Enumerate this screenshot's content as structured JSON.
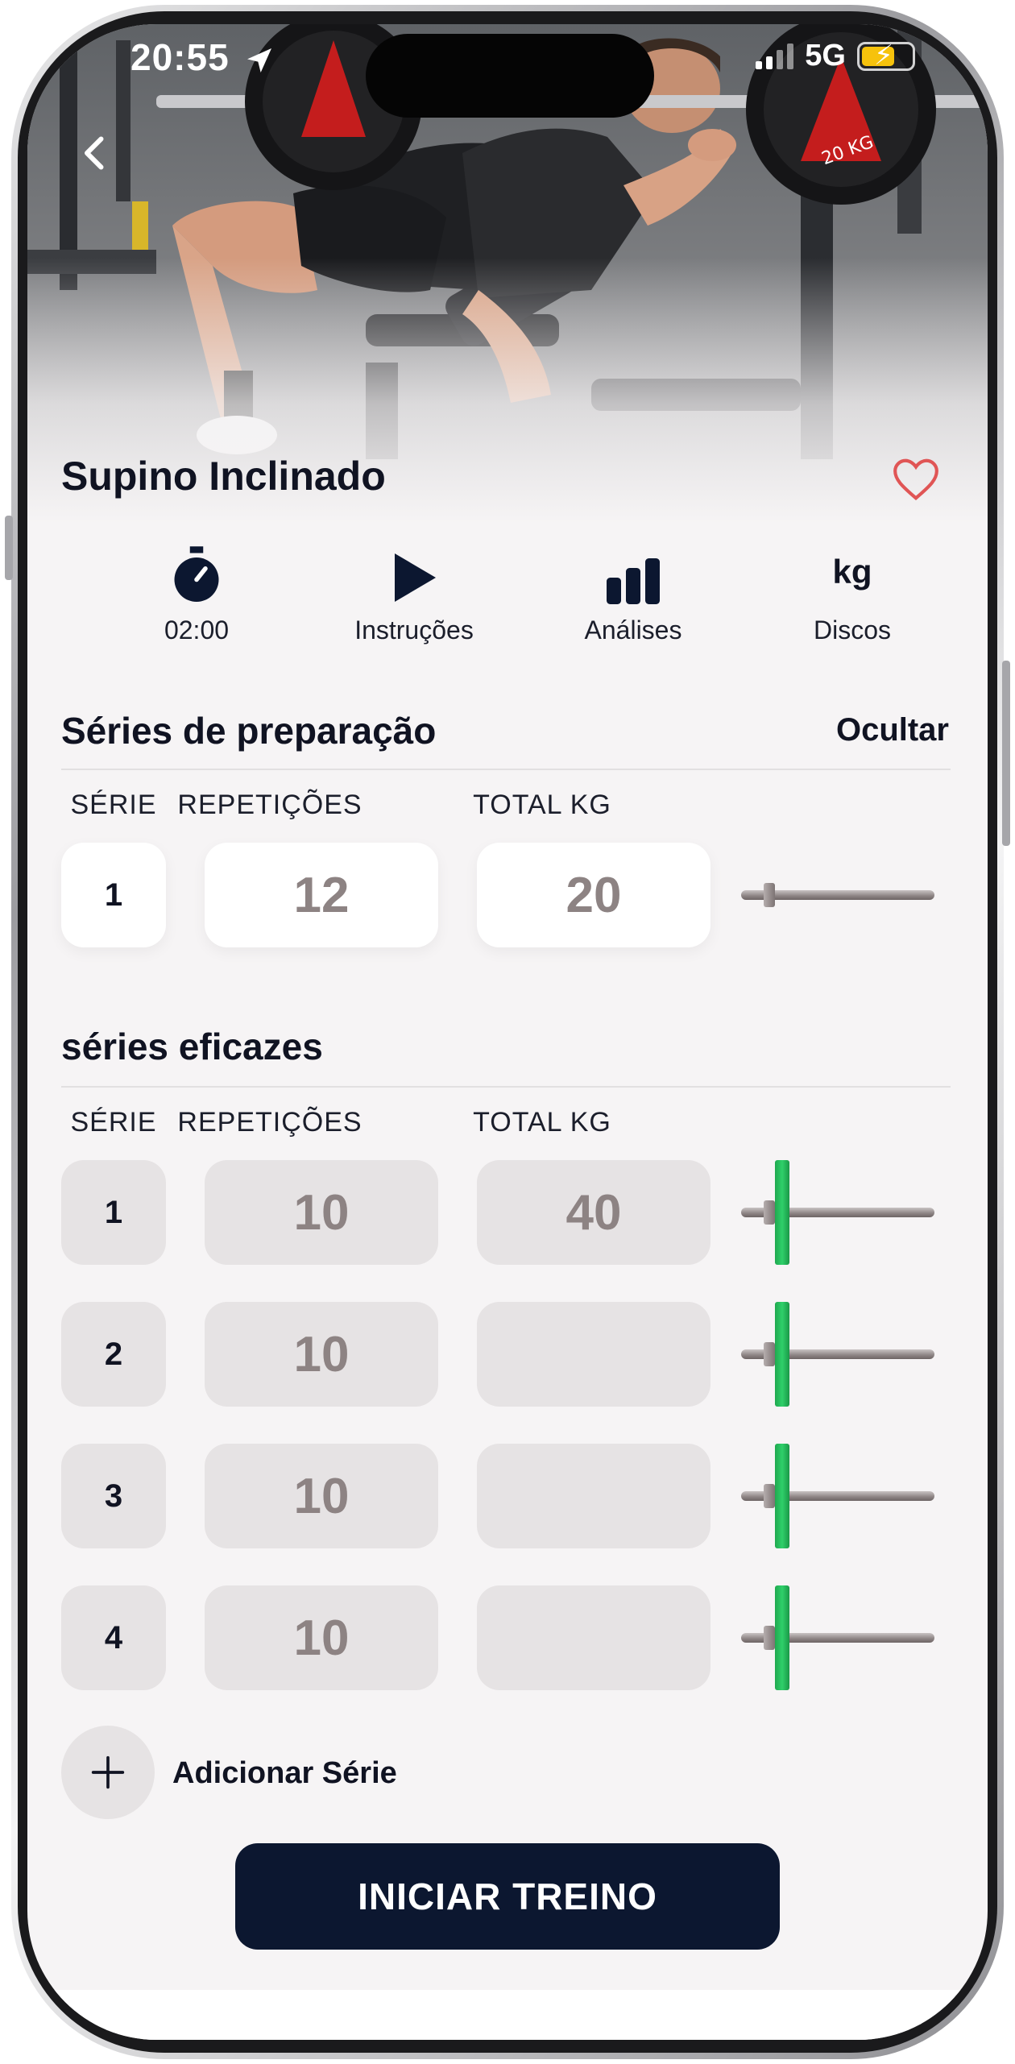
{
  "status": {
    "time": "20:55",
    "network": "5G"
  },
  "exercise": {
    "title": "Supino Inclinado"
  },
  "tools": [
    {
      "label": "02:00",
      "icon": "stopwatch-icon"
    },
    {
      "label": "Instruções",
      "icon": "play-icon"
    },
    {
      "label": "Análises",
      "icon": "bar-chart-icon"
    },
    {
      "label": "Discos",
      "icon_text": "kg"
    }
  ],
  "warmup": {
    "title": "Séries de preparação",
    "action": "Ocultar",
    "headers": {
      "set": "SÉRIE",
      "reps": "REPETIÇÕES",
      "total": "TOTAL KG"
    },
    "rows": [
      {
        "set": "1",
        "reps": "12",
        "total": "20"
      }
    ]
  },
  "effective": {
    "title": "séries eficazes",
    "headers": {
      "set": "SÉRIE",
      "reps": "REPETIÇÕES",
      "total": "TOTAL KG"
    },
    "rows": [
      {
        "set": "1",
        "reps": "10",
        "total": "40"
      },
      {
        "set": "2",
        "reps": "10",
        "total": ""
      },
      {
        "set": "3",
        "reps": "10",
        "total": ""
      },
      {
        "set": "4",
        "reps": "10",
        "total": ""
      }
    ]
  },
  "add_set": {
    "label": "Adicionar Série",
    "icon": "plus-icon"
  },
  "start_button": {
    "label": "INICIAR TREINO"
  },
  "colors": {
    "accent": "#0c1730",
    "plate": "#2fd06a",
    "heart": "#e05555"
  }
}
